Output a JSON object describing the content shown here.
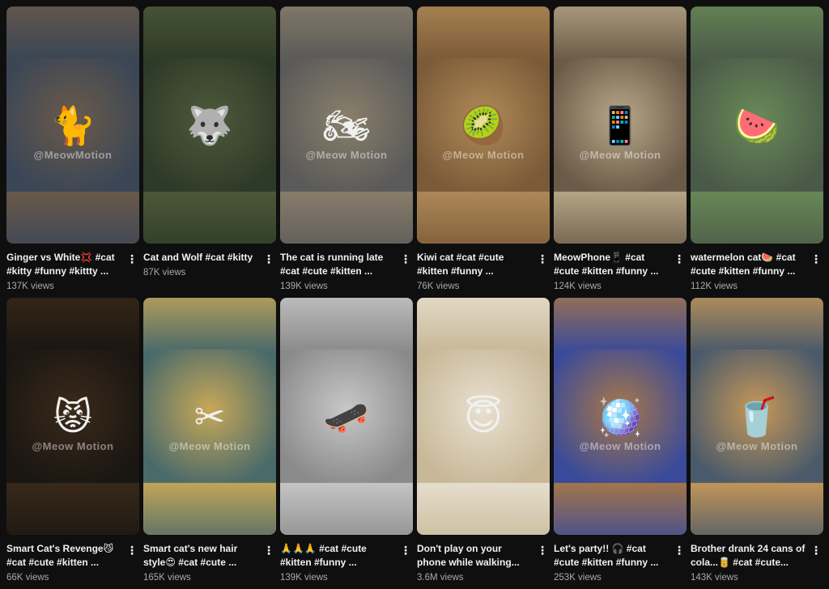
{
  "videos": [
    {
      "title": "Ginger vs White💢 #cat #kitty #funny #kittty ...",
      "views": "137K views",
      "watermark": "@MeowMotion",
      "icon": "cat-falling-icon",
      "glyph": "🐈",
      "bg": "#3a4656",
      "bg2": "#6b5a4a"
    },
    {
      "title": "Cat and Wolf #cat #kitty",
      "views": "87K views",
      "watermark": "",
      "icon": "wolf-icon",
      "glyph": "🐺",
      "bg": "#2e3a28",
      "bg2": "#4e5a3a"
    },
    {
      "title": "The cat is running late #cat #cute #kitten ...",
      "views": "139K views",
      "watermark": "@Meow Motion",
      "icon": "motorbike-icon",
      "glyph": "🏍",
      "bg": "#5a5a5a",
      "bg2": "#8a7f6a"
    },
    {
      "title": "Kiwi cat #cat #cute #kitten #funny ...",
      "views": "76K views",
      "watermark": "@Meow Motion",
      "icon": "kiwi-icon",
      "glyph": "🥝",
      "bg": "#7a5a38",
      "bg2": "#b08a58"
    },
    {
      "title": "MeowPhone📱 #cat #cute #kitten #funny ...",
      "views": "124K views",
      "watermark": "@Meow Motion",
      "icon": "kitten-phone-icon",
      "glyph": "📱",
      "bg": "#6a5a48",
      "bg2": "#b8a888"
    },
    {
      "title": "watermelon cat🍉 #cat #cute #kitten #funny ...",
      "views": "112K views",
      "watermark": "",
      "icon": "watermelon-icon",
      "glyph": "🍉",
      "bg": "#4a5a48",
      "bg2": "#6a8a58"
    },
    {
      "title": "Smart Cat's Revenge😼 #cat #cute #kitten ...",
      "views": "66K views",
      "watermark": "@Meow Motion",
      "icon": "cat-office-icon",
      "glyph": "😾",
      "bg": "#1a1612",
      "bg2": "#3a2a1a"
    },
    {
      "title": "Smart cat's new hair style😍 #cat #cute ...",
      "views": "165K views",
      "watermark": "@Meow Motion",
      "icon": "scissors-icon",
      "glyph": "✂",
      "bg": "#4a6a6a",
      "bg2": "#c8a858"
    },
    {
      "title": "🙏🙏🙏 #cat #cute #kitten #funny ...",
      "views": "139K views",
      "watermark": "",
      "icon": "skateboard-icon",
      "glyph": "🛹",
      "bg": "#8a8a8a",
      "bg2": "#c8c8c8"
    },
    {
      "title": "Don't play on your phone while walking...",
      "views": "3.6M views",
      "watermark": "",
      "icon": "angel-cat-icon",
      "glyph": "😇",
      "bg": "#c8b898",
      "bg2": "#e8e0d0"
    },
    {
      "title": "Let's party!! 🎧 #cat #cute #kitten #funny ...",
      "views": "253K views",
      "watermark": "@Meow Motion",
      "icon": "disco-ball-icon",
      "glyph": "🪩",
      "bg": "#3a4a9a",
      "bg2": "#a87848"
    },
    {
      "title": "Brother drank 24 cans of cola...🥫 #cat #cute...",
      "views": "143K views",
      "watermark": "@Meow Motion",
      "icon": "cola-can-icon",
      "glyph": "🥤",
      "bg": "#4a5a6a",
      "bg2": "#c89858"
    }
  ],
  "kebab_glyph": "⋮"
}
